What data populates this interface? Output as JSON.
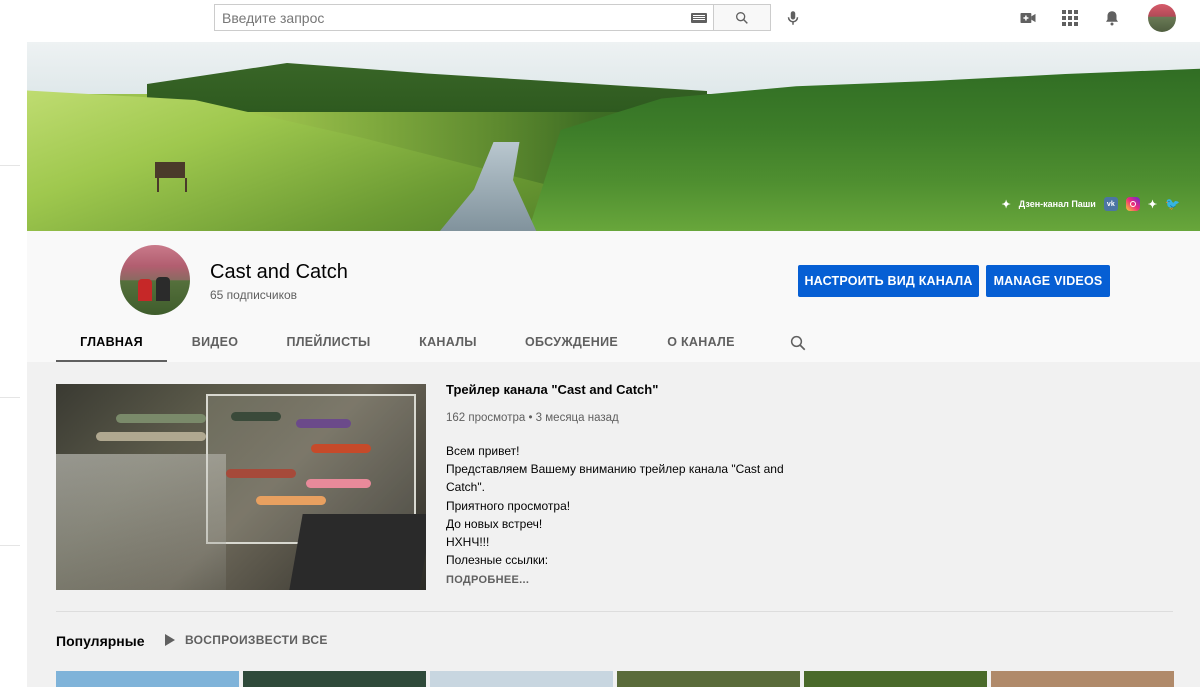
{
  "masthead": {
    "search_placeholder": "Введите запрос",
    "icons": [
      "keyboard-icon",
      "search-icon",
      "mic-icon",
      "video-camera-icon",
      "apps-grid-icon",
      "bell-icon"
    ]
  },
  "banner": {
    "links": [
      {
        "label": "Дзен-канал Паши",
        "icon": "zen-icon"
      },
      {
        "label": "",
        "icon": "vk-icon"
      },
      {
        "label": "",
        "icon": "instagram-icon"
      },
      {
        "label": "",
        "icon": "zen-icon"
      },
      {
        "label": "",
        "icon": "twitter-icon"
      }
    ],
    "vk_text": "vk"
  },
  "channel": {
    "title": "Cast and Catch",
    "subscribers": "65 подписчиков",
    "customize_button": "НАСТРОИТЬ ВИД КАНАЛА",
    "manage_button": "MANAGE VIDEOS"
  },
  "tabs": [
    {
      "label": "ГЛАВНАЯ",
      "active": true
    },
    {
      "label": "ВИДЕО",
      "active": false
    },
    {
      "label": "ПЛЕЙЛИСТЫ",
      "active": false
    },
    {
      "label": "КАНАЛЫ",
      "active": false
    },
    {
      "label": "ОБСУЖДЕНИЕ",
      "active": false
    },
    {
      "label": "О КАНАЛЕ",
      "active": false
    }
  ],
  "trailer": {
    "title": "Трейлер канала \"Cast and Catch\"",
    "meta": "162 просмотра • 3 месяца назад",
    "description": [
      "Всем привет!",
      "Представляем Вашему вниманию трейлер канала \"Cast and Catch\".",
      "Приятного просмотра!",
      "До новых встреч!",
      "НХНЧ!!!",
      "Полезные ссылки:"
    ],
    "more": "ПОДРОБНЕЕ..."
  },
  "popular": {
    "title": "Популярные",
    "play_all": "ВОСПРОИЗВЕСТИ ВСЕ",
    "thumb_colors": [
      "#7fb3d9",
      "#2f4a3a",
      "#c8d6e0",
      "#5a6b3a",
      "#4a6a2a",
      "#b08a6a",
      "#6a8a9a"
    ]
  },
  "colors": {
    "accent_blue": "#065fd4",
    "header_bg": "#f9f9f9",
    "content_bg": "#f1f1f1"
  }
}
